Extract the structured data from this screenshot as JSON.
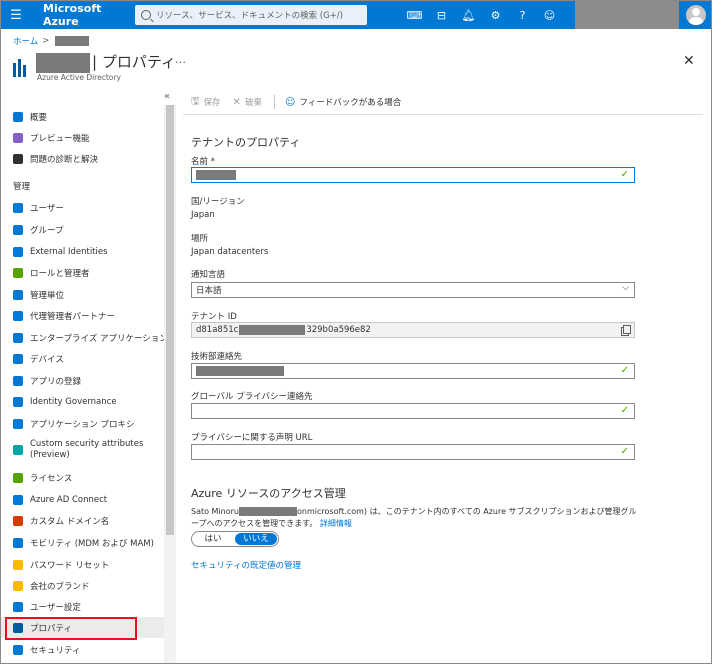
{
  "topbar": {
    "brand": "Microsoft Azure",
    "search_placeholder": "リソース、サービス、ドキュメントの検索 (G+/)",
    "icons": [
      "cloud-shell-icon",
      "directory-filter-icon",
      "notifications-icon",
      "settings-icon",
      "help-icon",
      "feedback-icon"
    ]
  },
  "breadcrumb": {
    "home": "ホーム",
    "separator": ">"
  },
  "header": {
    "title": "| プロパティ",
    "subtitle": "Azure Active Directory",
    "more": "…",
    "close": "✕"
  },
  "sidebar": {
    "collapse": "«",
    "section_manage": "管理",
    "items": [
      {
        "label": "概要",
        "icon": "info-icon",
        "color": "#0078d4"
      },
      {
        "label": "プレビュー機能",
        "icon": "preview-icon",
        "color": "#8661c5"
      },
      {
        "label": "問題の診断と解決",
        "icon": "wrench-icon",
        "color": "#323130"
      },
      {
        "label": "ユーザー",
        "icon": "user-icon",
        "color": "#0078d4"
      },
      {
        "label": "グループ",
        "icon": "group-icon",
        "color": "#0078d4"
      },
      {
        "label": "External Identities",
        "icon": "external-identities-icon",
        "color": "#0078d4"
      },
      {
        "label": "ロールと管理者",
        "icon": "roles-icon",
        "color": "#57a300"
      },
      {
        "label": "管理単位",
        "icon": "admin-units-icon",
        "color": "#0078d4"
      },
      {
        "label": "代理管理者パートナー",
        "icon": "partner-icon",
        "color": "#0078d4"
      },
      {
        "label": "エンタープライズ アプリケーション",
        "icon": "enterprise-apps-icon",
        "color": "#0078d4"
      },
      {
        "label": "デバイス",
        "icon": "devices-icon",
        "color": "#0078d4"
      },
      {
        "label": "アプリの登録",
        "icon": "app-registration-icon",
        "color": "#0078d4"
      },
      {
        "label": "Identity Governance",
        "icon": "governance-icon",
        "color": "#0078d4"
      },
      {
        "label": "アプリケーション プロキシ",
        "icon": "app-proxy-icon",
        "color": "#0078d4"
      },
      {
        "label": "Custom security attributes (Preview)",
        "icon": "security-attributes-icon",
        "color": "#00a4a6"
      },
      {
        "label": "ライセンス",
        "icon": "license-icon",
        "color": "#57a300"
      },
      {
        "label": "Azure AD Connect",
        "icon": "ad-connect-icon",
        "color": "#0078d4"
      },
      {
        "label": "カスタム ドメイン名",
        "icon": "custom-domain-icon",
        "color": "#d83b01"
      },
      {
        "label": "モビリティ (MDM および MAM)",
        "icon": "mobility-icon",
        "color": "#0078d4"
      },
      {
        "label": "パスワード リセット",
        "icon": "key-icon",
        "color": "#ffb900"
      },
      {
        "label": "会社のブランド",
        "icon": "branding-icon",
        "color": "#ffb900"
      },
      {
        "label": "ユーザー設定",
        "icon": "user-settings-icon",
        "color": "#0078d4"
      },
      {
        "label": "プロパティ",
        "icon": "properties-icon",
        "color": "#005ba1"
      },
      {
        "label": "セキュリティ",
        "icon": "shield-icon",
        "color": "#0078d4"
      }
    ]
  },
  "toolbar": {
    "save": "保存",
    "discard": "破棄",
    "feedback": "フィードバックがある場合"
  },
  "form": {
    "tenant_section": "テナントのプロパティ",
    "name_label": "名前 *",
    "country_label": "国/リージョン",
    "country_value": "Japan",
    "location_label": "場所",
    "location_value": "Japan datacenters",
    "language_label": "通知言語",
    "language_value": "日本語",
    "tenant_id_label": "テナント ID",
    "tenant_id_prefix": "d81a851c",
    "tenant_id_suffix": "329b0a596e82",
    "tech_contact_label": "技術部連絡先",
    "privacy_contact_label": "グローバル プライバシー連絡先",
    "privacy_url_label": "プライバシーに関する声明 URL",
    "azure_section": "Azure リソースのアクセス管理",
    "azure_desc_1": "Sato Minoru",
    "azure_desc_2": "onmicrosoft.com) は、このテナント内のすべての Azure サブスクリプションおよび管理グループへのアクセスを管理できます。",
    "azure_desc_link": "詳細情報",
    "toggle_yes": "はい",
    "toggle_no": "いいえ",
    "security_defaults_link": "セキュリティの既定値の管理"
  }
}
